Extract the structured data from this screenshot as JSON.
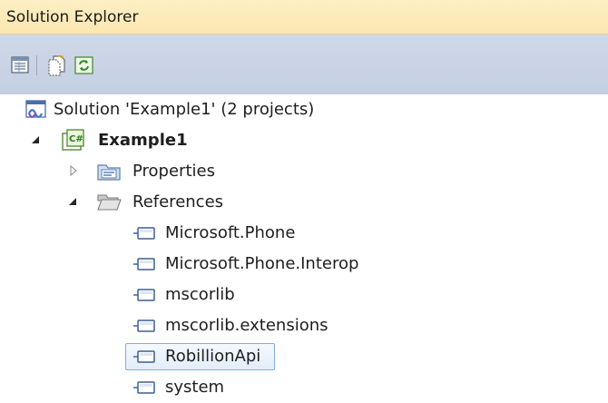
{
  "panel": {
    "title": "Solution Explorer"
  },
  "toolbar": {
    "buttons": [
      {
        "icon": "properties-window-icon"
      },
      {
        "icon": "show-all-files-icon"
      },
      {
        "icon": "refresh-icon"
      }
    ]
  },
  "tree": {
    "solution": {
      "label": "Solution 'Example1' (2 projects)",
      "icon": "solution-icon"
    },
    "project": {
      "label": "Example1",
      "icon": "csharp-project-icon",
      "expanded": true
    },
    "properties": {
      "label": "Properties",
      "icon": "properties-folder-icon",
      "expanded": false
    },
    "references": {
      "label": "References",
      "icon": "open-folder-icon",
      "expanded": true
    },
    "reference_items": [
      {
        "label": "Microsoft.Phone",
        "selected": false
      },
      {
        "label": "Microsoft.Phone.Interop",
        "selected": false
      },
      {
        "label": "mscorlib",
        "selected": false
      },
      {
        "label": "mscorlib.extensions",
        "selected": false
      },
      {
        "label": "RobillionApi",
        "selected": true
      },
      {
        "label": "system",
        "selected": false
      }
    ]
  },
  "colors": {
    "title_bar": "#fbe7b0",
    "toolbar": "#c8d2e4",
    "selection_border": "#84acdd",
    "selection_fill": "#e3edfa"
  }
}
